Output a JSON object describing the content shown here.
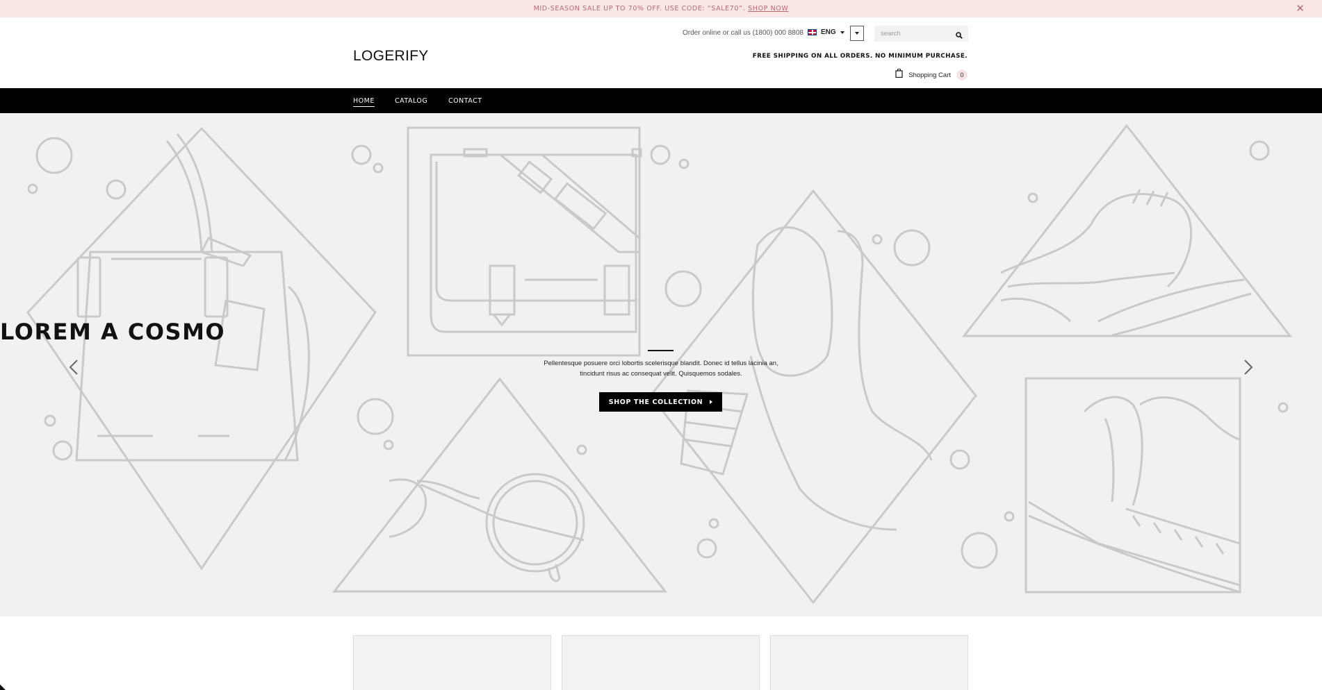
{
  "announcement": {
    "text": "MID-SEASON SALE UP TO 70% OFF. USE CODE: “SALE70”.",
    "link": "SHOP NOW",
    "close_icon": "close-icon"
  },
  "header": {
    "logo": "LOGERIFY",
    "order_text": "Order online or call us (1800) 000 8808",
    "language": "ENG",
    "search_placeholder": "search",
    "shipping_text": "FREE SHIPPING ON ALL ORDERS. NO MINIMUM PURCHASE.",
    "cart_label": "Shopping Cart",
    "cart_count": "0"
  },
  "nav": {
    "items": [
      {
        "label": "HOME",
        "active": true
      },
      {
        "label": "CATALOG",
        "active": false
      },
      {
        "label": "CONTACT",
        "active": false
      }
    ]
  },
  "hero": {
    "title": "LOREM A COSMO",
    "description": "Pellentesque posuere orci lobortis scelerisque blandit. Donec id tellus lacinia an, tincidunt risus ac consequat velit. Quisquemos sodales.",
    "button": "SHOP THE COLLECTION",
    "prev_icon": "chevron-left-icon",
    "next_icon": "chevron-right-icon"
  },
  "colors": {
    "announcement_bg": "#fbe6e6",
    "announcement_text": "#b56a74",
    "nav_bg": "#000000",
    "hero_bg": "#f0f1f3",
    "line_art": "#c8c8c8"
  }
}
